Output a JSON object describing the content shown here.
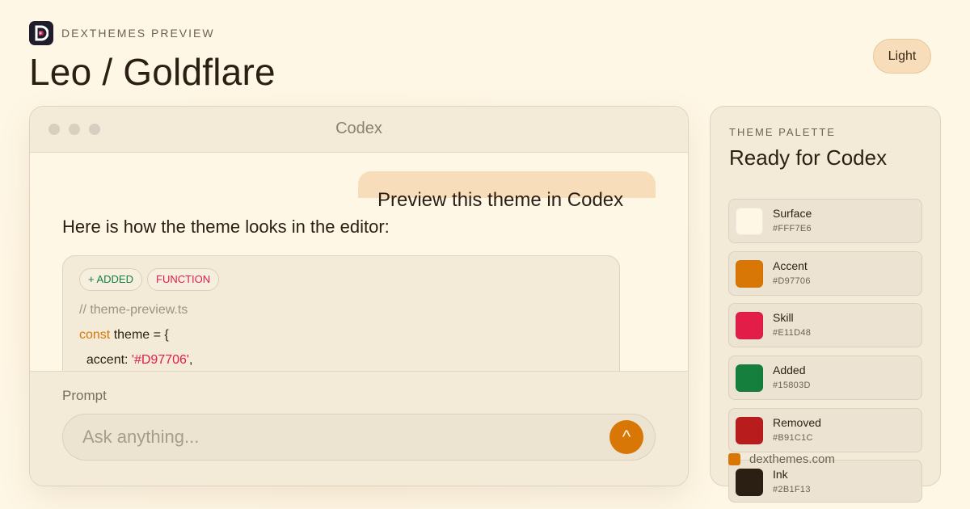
{
  "brand": {
    "name": "DEXTHEMES PREVIEW"
  },
  "page": {
    "title": "Leo / Goldflare"
  },
  "mode": {
    "label": "Light"
  },
  "window": {
    "title": "Codex",
    "user_message": "Preview this theme in Codex",
    "assistant_message": "Here is how the theme looks in the editor:",
    "chips": {
      "added": "+ ADDED",
      "function": "FUNCTION"
    },
    "code": {
      "comment": "// theme-preview.ts",
      "keyword": "const",
      "line2_rest": " theme = {",
      "line3_key": "  accent: ",
      "line3_value": "'#D97706'",
      "line3_end": ","
    },
    "prompt": {
      "label": "Prompt",
      "placeholder": "Ask anything...",
      "send_icon": "^"
    }
  },
  "palette": {
    "eyebrow": "THEME PALETTE",
    "title": "Ready for Codex",
    "swatches": [
      {
        "name": "Surface",
        "hex": "#FFF7E6"
      },
      {
        "name": "Accent",
        "hex": "#D97706"
      },
      {
        "name": "Skill",
        "hex": "#E11D48"
      },
      {
        "name": "Added",
        "hex": "#15803D"
      },
      {
        "name": "Removed",
        "hex": "#B91C1C"
      },
      {
        "name": "Ink",
        "hex": "#2B1F13"
      }
    ]
  },
  "footer": {
    "url": "dexthemes.com"
  },
  "colors": {
    "accent": "#D97706",
    "surface": "#FFF7E6",
    "skill": "#E11D48",
    "added": "#15803D",
    "removed": "#B91C1C",
    "ink": "#2B1F13"
  }
}
